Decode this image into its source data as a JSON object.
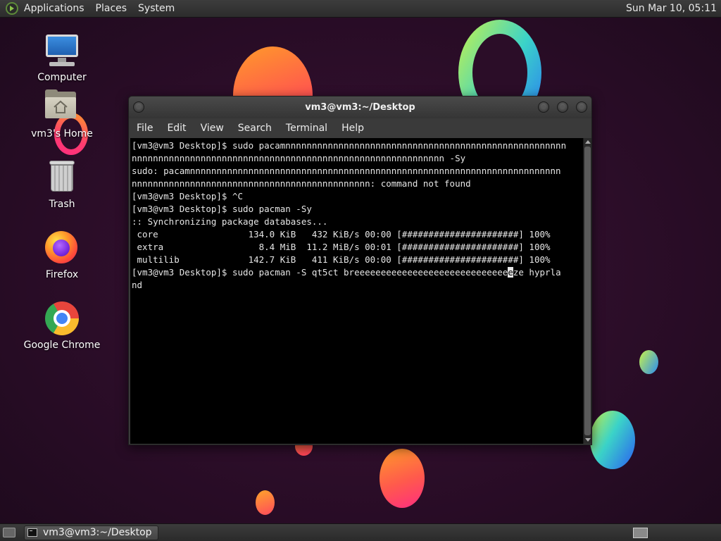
{
  "top_panel": {
    "menus": [
      "Applications",
      "Places",
      "System"
    ],
    "clock": "Sun Mar 10, 05:11"
  },
  "desktop_icons": [
    {
      "label": "Computer",
      "icon": "computer-icon"
    },
    {
      "label": "vm3's Home",
      "icon": "home-folder-icon"
    },
    {
      "label": "Trash",
      "icon": "trash-icon"
    },
    {
      "label": "Firefox",
      "icon": "firefox-icon"
    },
    {
      "label": "Google Chrome",
      "icon": "chrome-icon"
    }
  ],
  "terminal": {
    "title": "vm3@vm3:~/Desktop",
    "menu": [
      "File",
      "Edit",
      "View",
      "Search",
      "Terminal",
      "Help"
    ],
    "lines": [
      "[vm3@vm3 Desktop]$ sudo pacamnnnnnnnnnnnnnnnnnnnnnnnnnnnnnnnnnnnnnnnnnnnnnnnnnnnnn",
      "nnnnnnnnnnnnnnnnnnnnnnnnnnnnnnnnnnnnnnnnnnnnnnnnnnnnnnnnnnn -Sy",
      "sudo: pacamnnnnnnnnnnnnnnnnnnnnnnnnnnnnnnnnnnnnnnnnnnnnnnnnnnnnnnnnnnnnnnnnnnnnnn",
      "nnnnnnnnnnnnnnnnnnnnnnnnnnnnnnnnnnnnnnnnnnnnn: command not found",
      "[vm3@vm3 Desktop]$ ^C",
      "[vm3@vm3 Desktop]$ sudo pacman -Sy",
      ":: Synchronizing package databases...",
      " core                 134.0 KiB   432 KiB/s 00:00 [######################] 100%",
      " extra                  8.4 MiB  11.2 MiB/s 00:01 [######################] 100%",
      " multilib             142.7 KiB   411 KiB/s 00:00 [######################] 100%"
    ],
    "prompt_line": {
      "before_cursor": "[vm3@vm3 Desktop]$ sudo pacman -S qt5ct breeeeeeeeeeeeeeeeeeeeeeeeeeeee",
      "cursor_char": "e",
      "after_cursor": "ze hyprla"
    },
    "wrap_line": "nd"
  },
  "taskbar": {
    "window_button": "vm3@vm3:~/Desktop"
  },
  "colors": {
    "panel": "#333333",
    "terminal_bg": "#000000",
    "terminal_fg": "#e6e6e6",
    "wallpaper": "#2b0d28"
  }
}
